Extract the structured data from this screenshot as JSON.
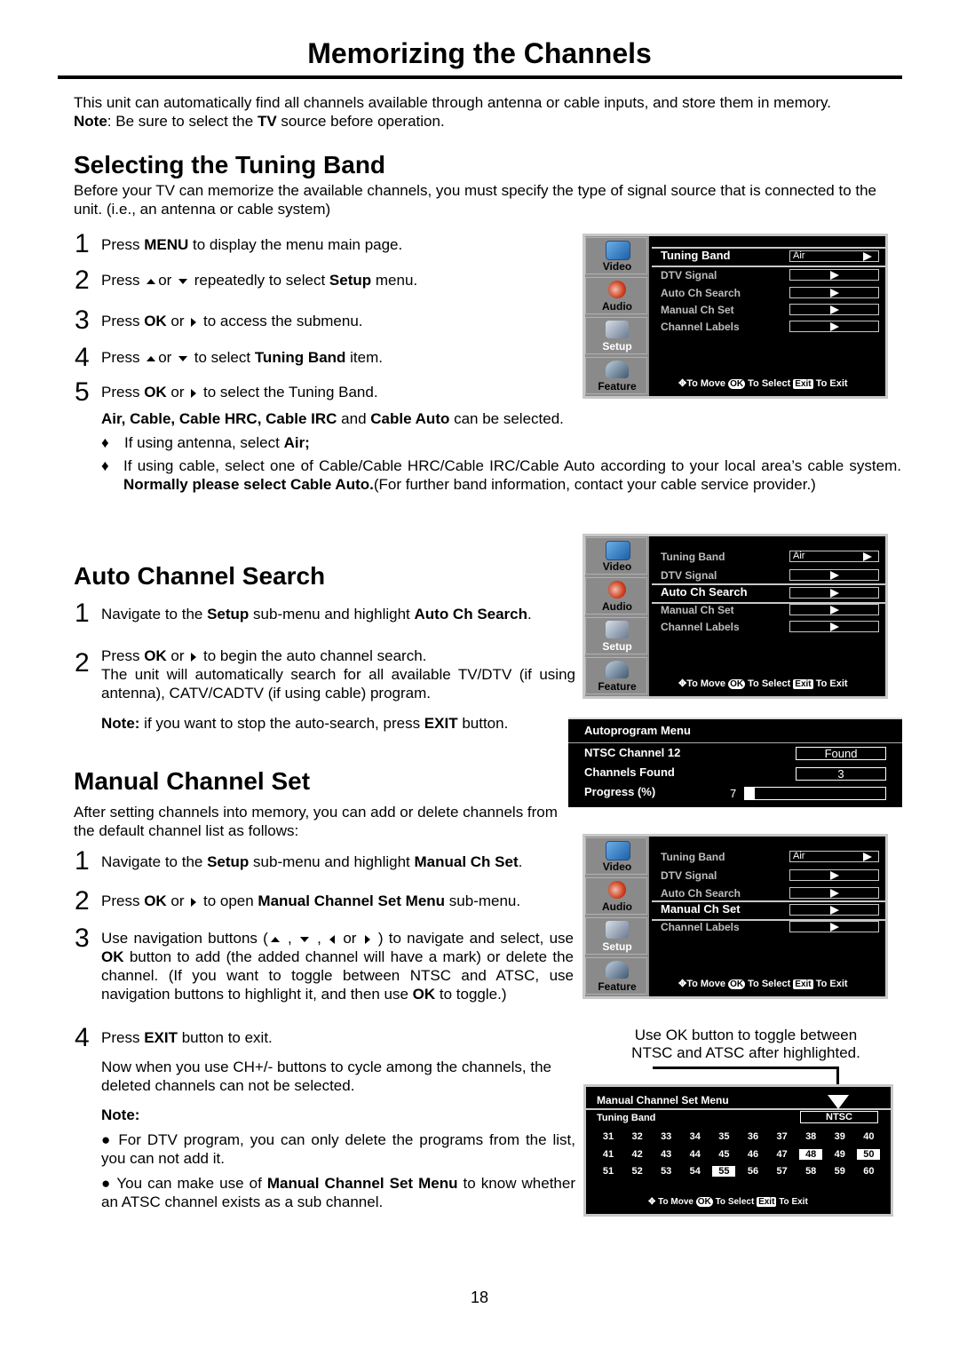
{
  "page": {
    "title": "Memorizing the Channels",
    "intro": "This unit can automatically find all channels available through antenna or cable inputs, and store them in memory.",
    "note_label": "Note",
    "note_pre": ":  Be sure to select the ",
    "note_bold": "TV",
    "note_post": " source before operation.",
    "page_number": "18"
  },
  "tuning_band": {
    "heading": "Selecting the Tuning Band",
    "intro": "Before your TV can memorize the available channels, you must specify the type of signal source that is connected to the unit. (i.e., an antenna or cable system)",
    "steps": [
      {
        "num": "1",
        "a": "Press  ",
        "b": "MENU",
        "c": " to display the menu main page."
      },
      {
        "num": "2",
        "a": "Press ",
        "or": "or",
        "c": " repeatedly to select ",
        "d": "Setup",
        "e": " menu."
      },
      {
        "num": "3",
        "a": "Press ",
        "b": "OK",
        "c": " or ",
        "d": " to access the submenu."
      },
      {
        "num": "4",
        "a": "Press ",
        "or": "or",
        "c": " to select ",
        "d": "Tuning Band",
        "e": " item."
      },
      {
        "num": "5",
        "a": "Press ",
        "b": "OK",
        "c": "  or  ",
        "d": " to select the Tuning Band."
      }
    ],
    "options_bold": "Air, Cable, Cable HRC, Cable IRC",
    "options_and": " and ",
    "options_bold2": "Cable Auto",
    "options_post": " can be selected.",
    "bullets": [
      {
        "pre": "If using antenna, select ",
        "bold": "Air;"
      },
      {
        "pre": "If using cable,  select one of Cable/Cable HRC/Cable IRC/Cable  Auto according to your local area’s cable system.  ",
        "bold": "Normally please select Cable Auto.",
        "post": "(For further band information,  contact your cable service provider.)"
      }
    ]
  },
  "auto_search": {
    "heading": "Auto Channel Search",
    "step1": {
      "num": "1",
      "a": "Navigate to the ",
      "b": "Setup",
      "c": " sub-menu and highlight ",
      "d": "Auto Ch Search",
      "e": "."
    },
    "step2": {
      "num": "2",
      "a": "Press ",
      "b": "OK",
      "c": "  or ",
      "d": " to begin the auto channel search.",
      "e": "The unit will automatically search for all available TV/DTV (if using antenna), CATV/CADTV (if using cable) program."
    },
    "note_label": "Note:",
    "note_pre": " if you want to stop the auto-search, press ",
    "note_bold": "EXIT",
    "note_post": " button."
  },
  "manual_set": {
    "heading": "Manual Channel Set",
    "intro": "After setting channels into memory, you can add or delete channels from the default channel list as follows:",
    "step1": {
      "num": "1",
      "a": "Navigate to the ",
      "b": "Setup",
      "c": " sub-menu and highlight ",
      "d": "Manual Ch Set",
      "e": "."
    },
    "step2": {
      "num": "2",
      "a": "Press ",
      "b": "OK",
      "c": "  or ",
      "d": " to open ",
      "e": "Manual Channel Set Menu",
      "f": " sub-menu."
    },
    "step3": {
      "num": "3",
      "a": "Use navigation buttons (",
      "sep1": " , ",
      "sep2": " , ",
      "or": " or ",
      "b": " ) to navigate and select, use ",
      "c": "OK",
      "d": " button to add (the added channel will have a mark) or delete the channel.   (If you want to toggle between NTSC and ATSC, use navigation buttons to highlight it, and then use ",
      "e": "OK",
      "f": " to toggle.)"
    },
    "step4": {
      "num": "4",
      "a": "Press ",
      "b": "EXIT",
      "c": " button to exit."
    },
    "after": "Now when you use CH+/- buttons to cycle among the channels, the deleted channels can not be selected.",
    "note_label": "Note:",
    "notes": [
      {
        "pre": " For DTV program, you can only delete the programs from the list, you can not add it."
      },
      {
        "pre": " You can make use of ",
        "bold": "Manual Channel Set Menu",
        "post": " to know whether an ATSC channel exists as a sub channel."
      }
    ],
    "callout": "Use OK button to toggle between NTSC and ATSC after highlighted."
  },
  "tv_menu": {
    "tabs": [
      {
        "label": "Video",
        "icon": "video-icon"
      },
      {
        "label": "Audio",
        "icon": "speaker-icon"
      },
      {
        "label": "Setup",
        "icon": "setup-icon"
      },
      {
        "label": "Feature",
        "icon": "feature-icon"
      }
    ],
    "items": [
      "Tuning Band",
      "DTV Signal",
      "Auto Ch Search",
      "Manual Ch Set",
      "Channel Labels"
    ],
    "tuning_value": "Air",
    "footer_move": "To Move",
    "footer_ok": "OK",
    "footer_select": "To Select",
    "footer_exit_key": "Exit",
    "footer_exit": "To Exit"
  },
  "autoprogram": {
    "title": "Autoprogram Menu",
    "ntsc_label": "NTSC Channel 12",
    "ntsc_value": "Found",
    "found_label": "Channels Found",
    "found_value": "3",
    "progress_label": "Progress (%)",
    "progress_value": "7",
    "progress_percent": 7
  },
  "manual_menu": {
    "title": "Manual Channel Set Menu",
    "tuning_label": "Tuning Band",
    "tuning_value": "NTSC",
    "rows": [
      [
        "31",
        "32",
        "33",
        "34",
        "35",
        "36",
        "37",
        "38",
        "39",
        "40"
      ],
      [
        "41",
        "42",
        "43",
        "44",
        "45",
        "46",
        "47",
        "48",
        "49",
        "50"
      ],
      [
        "51",
        "52",
        "53",
        "54",
        "55",
        "56",
        "57",
        "58",
        "59",
        "60"
      ]
    ],
    "marked": [
      "48",
      "50",
      "55"
    ],
    "footer_move": "To Move",
    "footer_ok": "OK",
    "footer_select": "To Select",
    "footer_exit_key": "Exit",
    "footer_exit": "To Exit"
  }
}
